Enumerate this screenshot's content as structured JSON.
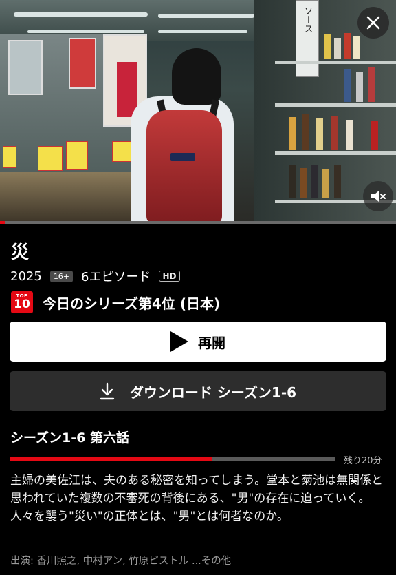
{
  "player": {
    "progress_fraction": 0.012,
    "close_icon": "close-icon",
    "mute_icon": "volume-mute-icon",
    "scene_sign_text": "ソース"
  },
  "title": "災",
  "meta": {
    "year": "2025",
    "maturity_rating": "16+",
    "episodes": "6エピソード",
    "quality": "HD"
  },
  "ranking": {
    "badge_top": "TOP",
    "badge_number": "10",
    "text": "今日のシリーズ第4位 (日本)"
  },
  "buttons": {
    "resume_label": "再開",
    "download_label": "ダウンロード シーズン1-6"
  },
  "episode": {
    "label": "シーズン1-6 第六話",
    "progress_fraction": 0.62,
    "remaining": "残り20分"
  },
  "description": "主婦の美佐江は、夫のある秘密を知ってしまう。堂本と菊池は無関係と思われていた複数の不審死の背後にある、\"男\"の存在に迫っていく。人々を襲う\"災い\"の正体とは、\"男\"とは何者なのか。",
  "cast": "出演: 香川照之, 中村アン, 竹原ピストル ...その他",
  "colors": {
    "accent": "#e50914",
    "background": "#000000",
    "secondary_button": "#2d2d2d"
  }
}
